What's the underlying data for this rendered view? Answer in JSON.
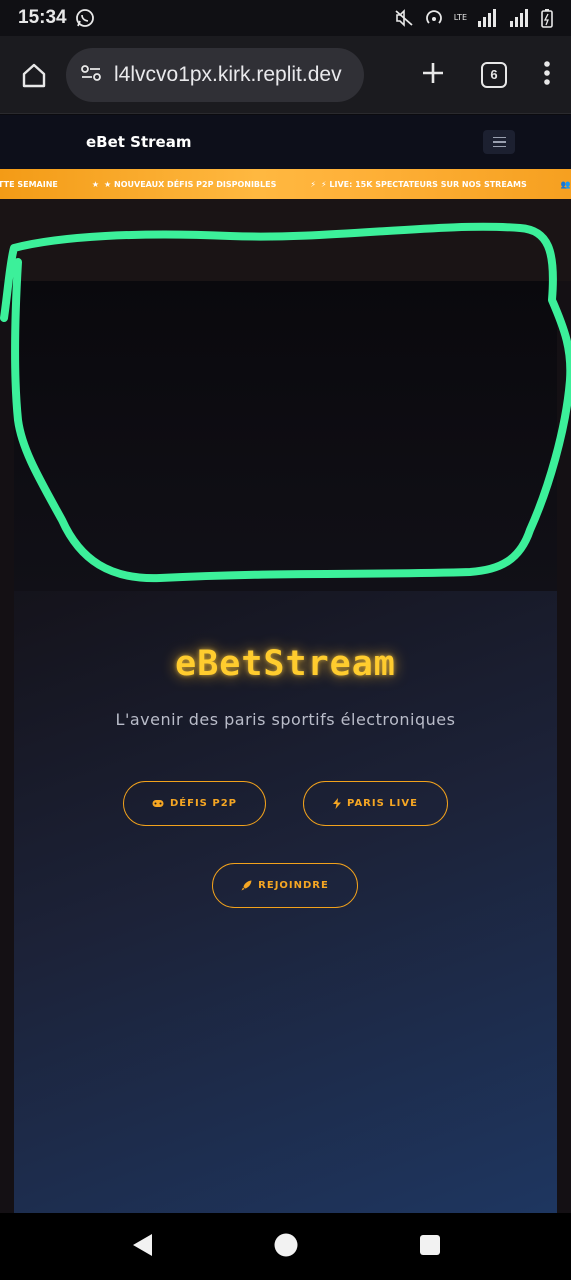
{
  "status_bar": {
    "time": "15:34",
    "network_label": "LTE",
    "icons": [
      "whatsapp-icon",
      "mute-icon",
      "hotspot-icon",
      "signal-icon",
      "signal-icon",
      "battery-icon"
    ]
  },
  "browser": {
    "url": "l4lvcvo1px.kirk.replit.dev",
    "tab_count": "6",
    "icons": [
      "home-icon",
      "site-settings-icon",
      "new-tab-icon",
      "more-icon"
    ]
  },
  "site": {
    "logo": "eBet Stream",
    "menu_icon": "hamburger-icon",
    "ticker": [
      {
        "icon": "",
        "text": "TTE SEMAINE"
      },
      {
        "icon": "★",
        "text": "★ NOUVEAUX DÉFIS P2P DISPONIBLES"
      },
      {
        "icon": "⚡",
        "text": "⚡ LIVE: 15K SPECTATEURS SUR NOS STREAMS"
      },
      {
        "icon": "👥",
        "text": "👥"
      }
    ],
    "hero": {
      "title": "eBetStream",
      "subtitle": "L'avenir des paris sportifs électroniques",
      "buttons": {
        "p2p": "DÉFIS P2P",
        "live": "PARIS LIVE",
        "join": "REJOINDRE"
      }
    }
  },
  "colors": {
    "accent": "#f5a623",
    "title": "#ffcc2e",
    "annotation": "#3cf09a",
    "header_bg": "#0d0f1a"
  },
  "nav_bar": {
    "icons": [
      "back-icon",
      "home-circle-icon",
      "recents-icon"
    ]
  }
}
